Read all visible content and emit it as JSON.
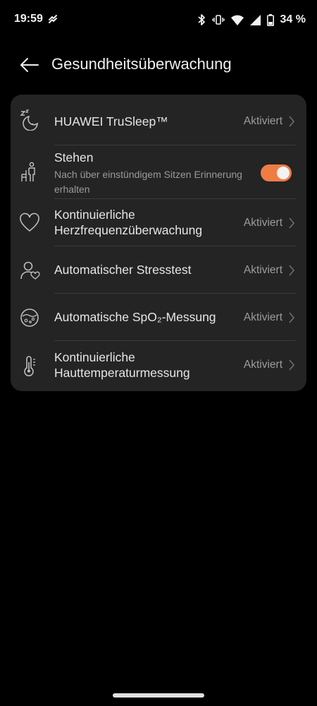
{
  "statusbar": {
    "time": "19:59",
    "battery_text": "34 %",
    "icons": [
      "link-icon",
      "bluetooth-icon",
      "vibrate-icon",
      "wifi-icon",
      "signal-icon",
      "battery-icon"
    ]
  },
  "header": {
    "title": "Gesundheitsüberwachung",
    "back_icon": "back-arrow-icon"
  },
  "colors": {
    "background": "#000000",
    "card": "#242424",
    "accent": "#ef7c43"
  },
  "settings": {
    "items": [
      {
        "title": "HUAWEI TruSleep™",
        "status": "Aktiviert",
        "icon": "sleep-moon-icon"
      },
      {
        "title": "Stehen",
        "subtitle": "Nach über einstündigem Sitzen Erinnerung erhalten",
        "toggle_on": true,
        "icon": "standing-person-icon"
      },
      {
        "title": "Kontinuierliche Herzfrequenzüberwachung",
        "status": "Aktiviert",
        "icon": "heart-icon"
      },
      {
        "title": "Automatischer Stresstest",
        "status": "Aktiviert",
        "icon": "stress-person-icon"
      },
      {
        "title": "Automatische SpO₂-Messung",
        "status": "Aktiviert",
        "icon": "blood-oxygen-icon"
      },
      {
        "title": "Kontinuierliche Hauttemperaturmessung",
        "status": "Aktiviert",
        "icon": "thermometer-icon"
      }
    ]
  }
}
